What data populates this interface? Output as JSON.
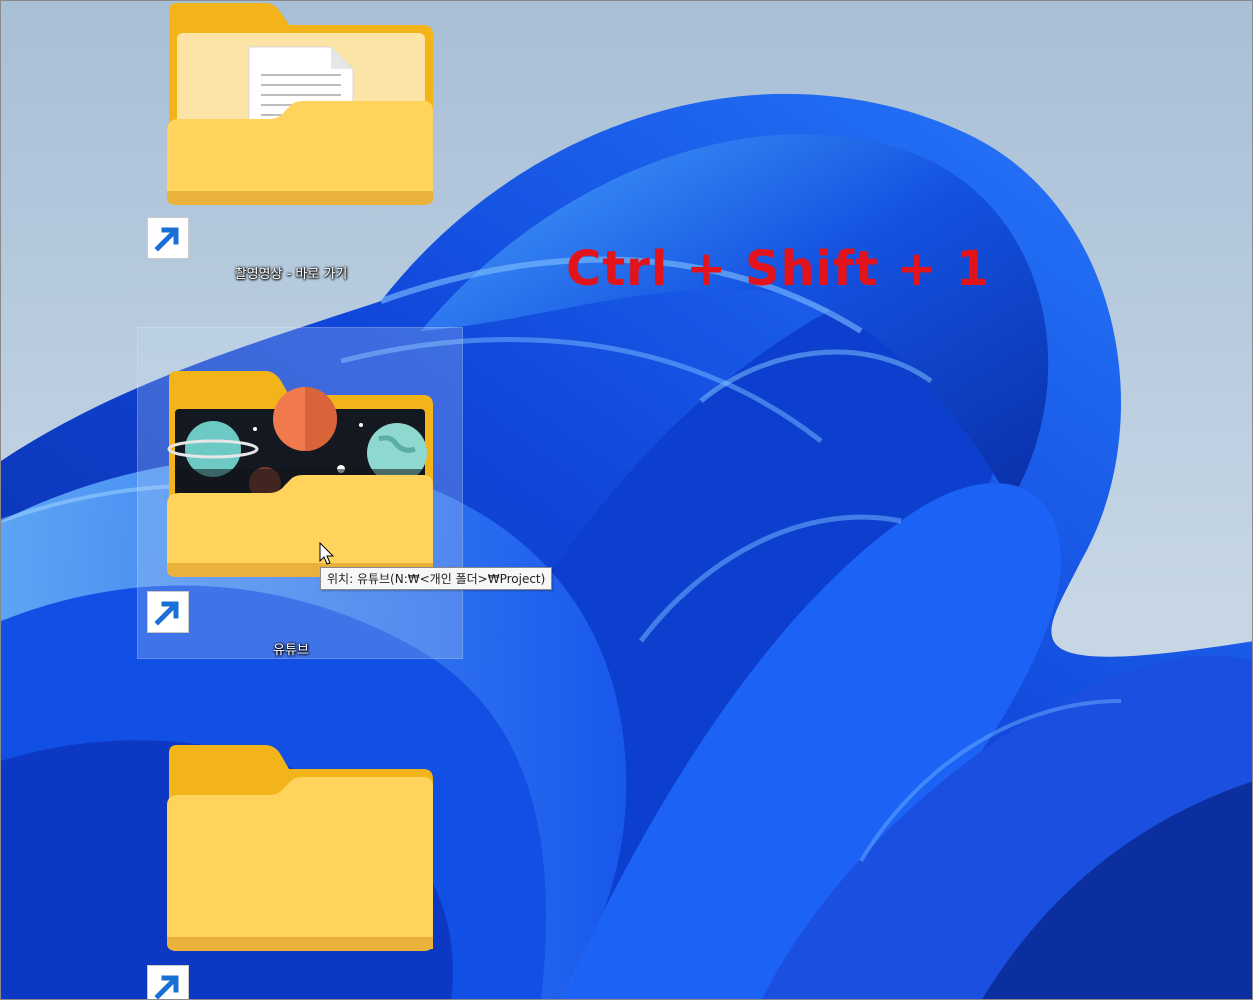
{
  "desktop": {
    "icons": [
      {
        "label": "촬영영상 - 바로 가기",
        "kind": "folder-with-document"
      },
      {
        "label": "유튜브",
        "kind": "folder-with-planets"
      },
      {
        "label": "",
        "kind": "empty-folder"
      }
    ],
    "tooltip": {
      "text": "위치: 유튜브(N:₩<개인 폴더>₩Project)"
    },
    "overlay_hotkey": {
      "text": "Ctrl + Shift + 1",
      "color": "#e3131b"
    }
  },
  "colors": {
    "folder_back": "#f2b418",
    "folder_front": "#ffd35c",
    "wallpaper_blue": "#1553e6",
    "shortcut_arrow": "#1a6fd6"
  }
}
